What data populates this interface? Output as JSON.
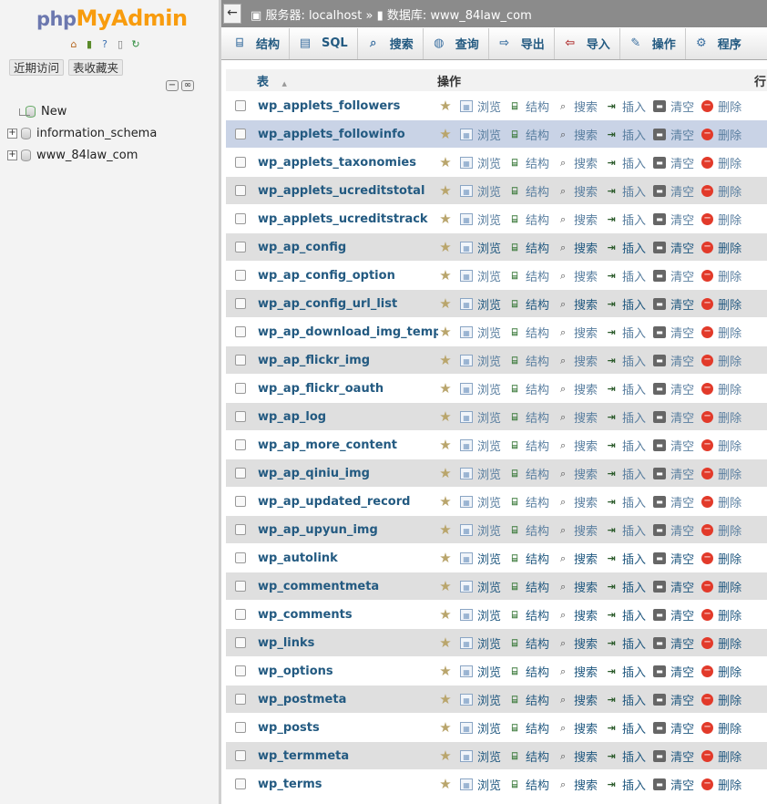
{
  "sidebar": {
    "logo_php": "php",
    "logo_myadmin": "MyAdmin",
    "icons": [
      "home-icon",
      "logout-icon",
      "help-icon",
      "docs-icon",
      "reload-icon"
    ],
    "tabs": [
      "近期访问",
      "表收藏夹"
    ],
    "tree": [
      {
        "label": "New",
        "type": "new"
      },
      {
        "label": "information_schema",
        "type": "db"
      },
      {
        "label": "www_84law_com",
        "type": "db"
      }
    ]
  },
  "topbar": {
    "back": "←",
    "server_label": "服务器: localhost",
    "separator": "»",
    "db_label": "数据库: www_84law_com"
  },
  "menu": [
    {
      "label": "结构",
      "icon": "structure-icon"
    },
    {
      "label": "SQL",
      "icon": "sql-icon"
    },
    {
      "label": "搜索",
      "icon": "search-icon"
    },
    {
      "label": "查询",
      "icon": "query-icon"
    },
    {
      "label": "导出",
      "icon": "export-icon"
    },
    {
      "label": "导入",
      "icon": "import-icon"
    },
    {
      "label": "操作",
      "icon": "wrench-icon"
    },
    {
      "label": "程序",
      "icon": "routines-icon"
    }
  ],
  "table_header": {
    "table": "表",
    "sort_arrow": "▲",
    "actions": "操作",
    "rows": "行"
  },
  "actions": {
    "browse": "浏览",
    "structure": "结构",
    "search": "搜索",
    "insert": "插入",
    "empty": "清空",
    "drop": "删除"
  },
  "tables": [
    {
      "name": "wp_applets_followers",
      "active": false
    },
    {
      "name": "wp_applets_followinfo",
      "active": false
    },
    {
      "name": "wp_applets_taxonomies",
      "active": false
    },
    {
      "name": "wp_applets_ucreditstotal",
      "active": false
    },
    {
      "name": "wp_applets_ucreditstrack",
      "active": false
    },
    {
      "name": "wp_ap_config",
      "active": true
    },
    {
      "name": "wp_ap_config_option",
      "active": false
    },
    {
      "name": "wp_ap_config_url_list",
      "active": true
    },
    {
      "name": "wp_ap_download_img_temp",
      "active": false
    },
    {
      "name": "wp_ap_flickr_img",
      "active": false
    },
    {
      "name": "wp_ap_flickr_oauth",
      "active": false
    },
    {
      "name": "wp_ap_log",
      "active": false
    },
    {
      "name": "wp_ap_more_content",
      "active": false
    },
    {
      "name": "wp_ap_qiniu_img",
      "active": false
    },
    {
      "name": "wp_ap_updated_record",
      "active": false
    },
    {
      "name": "wp_ap_upyun_img",
      "active": false
    },
    {
      "name": "wp_autolink",
      "active": true
    },
    {
      "name": "wp_commentmeta",
      "active": true
    },
    {
      "name": "wp_comments",
      "active": true
    },
    {
      "name": "wp_links",
      "active": true
    },
    {
      "name": "wp_options",
      "active": true
    },
    {
      "name": "wp_postmeta",
      "active": true
    },
    {
      "name": "wp_posts",
      "active": true
    },
    {
      "name": "wp_termmeta",
      "active": true
    },
    {
      "name": "wp_terms",
      "active": true
    }
  ],
  "colors": {
    "link": "#235a81",
    "highlight_row": "#c9d3e6",
    "even_row": "#dfdfdf",
    "topbar": "#8b8b8b",
    "logo_orange": "#f89c0e",
    "logo_purple": "#6c78af"
  }
}
